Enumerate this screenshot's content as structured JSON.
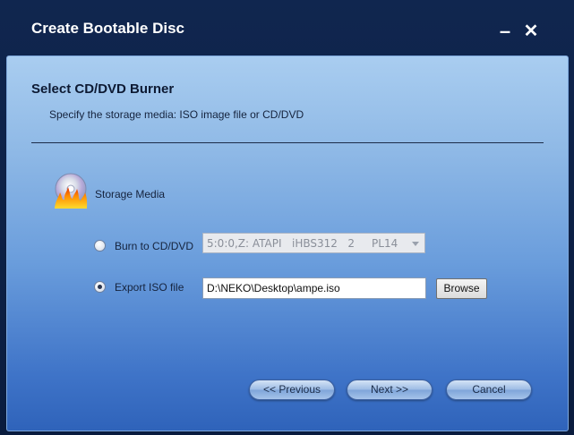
{
  "window": {
    "title": "Create Bootable Disc",
    "minimize_glyph": "–",
    "close_glyph": "✕"
  },
  "header": {
    "title": "Select CD/DVD Burner",
    "subtitle": "Specify the storage media: ISO image file or CD/DVD"
  },
  "storage": {
    "label": "Storage Media",
    "icon": "burning-disc-icon"
  },
  "options": {
    "burn_label": "Burn to CD/DVD",
    "burn_checked": false,
    "drive_value": "5:0:0,Z: ATAPI   iHBS312   2     PL14",
    "iso_label": "Export ISO file",
    "iso_checked": true,
    "iso_path": "D:\\NEKO\\Desktop\\ampe.iso",
    "browse_label": "Browse"
  },
  "buttons": {
    "previous": "<< Previous",
    "next": "Next >>",
    "cancel": "Cancel"
  },
  "colors": {
    "title_bar": "#10264f",
    "panel_top": "#a9cdf0",
    "panel_bottom": "#2f63ba"
  }
}
